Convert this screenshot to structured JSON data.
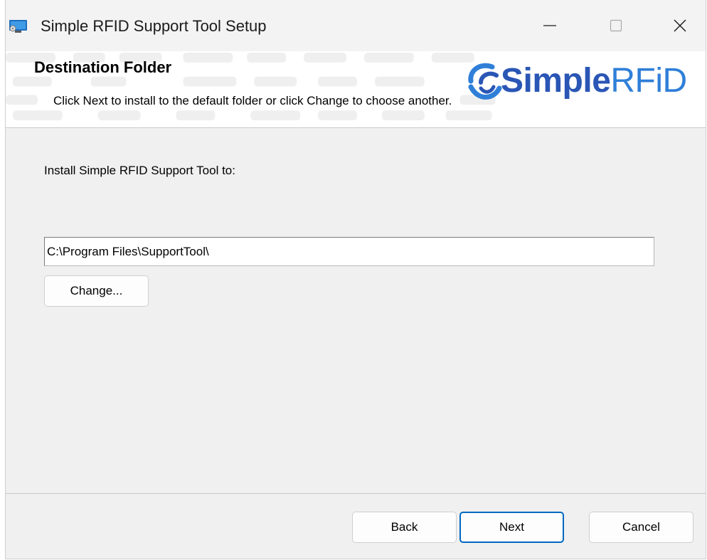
{
  "window": {
    "title": "Simple RFID Support Tool Setup",
    "icon": "installer-icon",
    "controls": {
      "minimize": "minimize-icon",
      "maximize": "maximize-icon",
      "close": "close-icon"
    }
  },
  "banner": {
    "title": "Destination Folder",
    "description": "Click Next to install to the default folder or click Change to choose another.",
    "logo": {
      "text_simple": "Simple",
      "text_rfid": "RFiD",
      "colors": {
        "dark_blue": "#2a56b5",
        "light_blue": "#2f7fd8"
      }
    }
  },
  "main": {
    "prompt": "Install Simple RFID Support Tool to:",
    "install_path": "C:\\Program Files\\SupportTool\\",
    "change_label": "Change..."
  },
  "footer": {
    "back_label": "Back",
    "next_label": "Next",
    "cancel_label": "Cancel"
  },
  "colors": {
    "accent": "#0067c0",
    "dialog_bg": "#f0f0f0",
    "banner_bg": "#ffffff"
  }
}
